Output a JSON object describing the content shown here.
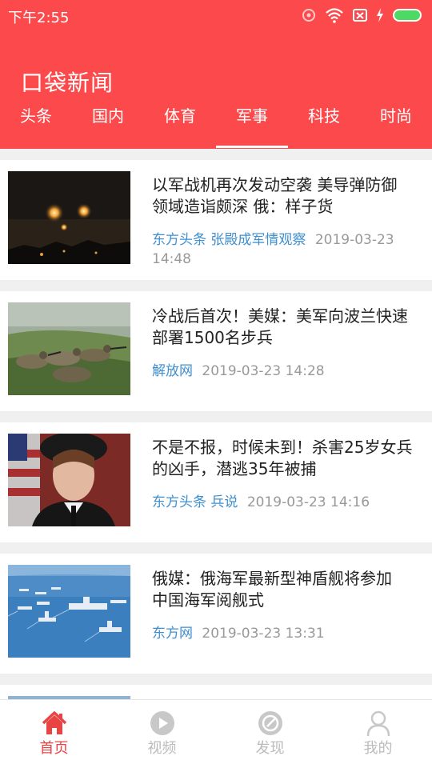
{
  "status_bar": {
    "time": "下午2:55"
  },
  "header": {
    "title": "口袋新闻",
    "background": "#fc4a4c"
  },
  "tabs": [
    {
      "label": "头条",
      "active": false
    },
    {
      "label": "国内",
      "active": false
    },
    {
      "label": "体育",
      "active": false
    },
    {
      "label": "军事",
      "active": true
    },
    {
      "label": "科技",
      "active": false
    },
    {
      "label": "时尚",
      "active": false
    }
  ],
  "news": [
    {
      "title_line1": "以军战机再次发动空袭 美导弹防御",
      "title_line2": "领域造诣颇深 俄：样子货",
      "sources": "东方头条  张殿成军情观察",
      "date": "2019-03-23",
      "time": "14:48",
      "image": "night-sky-flares"
    },
    {
      "title_line1": "冷战后首次！美媒：美军向波兰快速",
      "title_line2": "部署1500名步兵",
      "sources": "解放网",
      "datetime": "2019-03-23 14:28",
      "image": "soldiers-prone-on-grass"
    },
    {
      "title_line1": "不是不报，时候未到！杀害25岁女兵",
      "title_line2": "的凶手，潜逃35年被捕",
      "sources": "东方头条 兵说",
      "datetime": "2019-03-23 14:16",
      "image": "female-soldier-portrait"
    },
    {
      "title_line1": "俄媒：俄海军最新型神盾舰将参加",
      "title_line2": "中国海军阅舰式",
      "sources": "东方网",
      "datetime": "2019-03-23 13:31",
      "image": "naval-fleet-at-sea"
    }
  ],
  "tabbar": [
    {
      "label": "首页",
      "icon": "home-icon",
      "active": true
    },
    {
      "label": "视频",
      "icon": "play-icon",
      "active": false
    },
    {
      "label": "发现",
      "icon": "compass-icon",
      "active": false
    },
    {
      "label": "我的",
      "icon": "user-icon",
      "active": false
    }
  ],
  "colors": {
    "accent": "#fc4a4c",
    "source_link": "#3f8fd0",
    "tab_active": "#e84444"
  }
}
